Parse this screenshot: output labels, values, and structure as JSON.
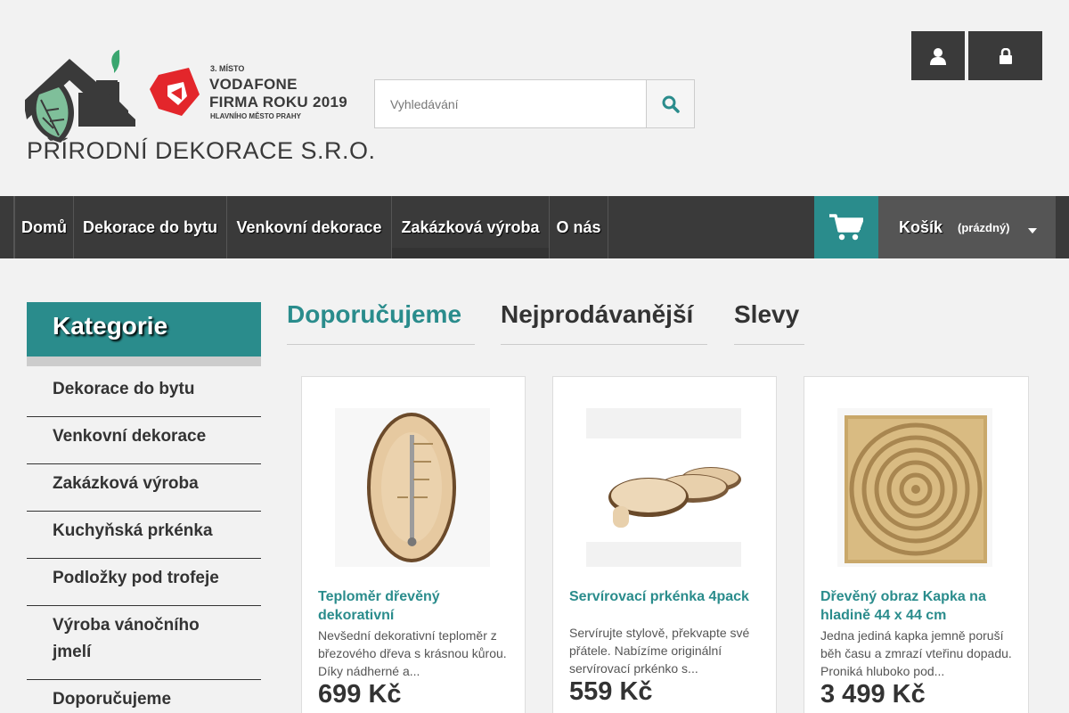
{
  "header": {
    "company_name": "PŘÍRODNÍ DEKORACE S.R.O.",
    "award_place": "3. MÍSTO",
    "award_line1": "VODAFONE",
    "award_line2": "FIRMA ROKU 2019",
    "award_line3": "HLAVNÍHO MĚSTO PRAHY",
    "search_placeholder": "Vyhledávání",
    "user_icon": "user-icon",
    "lock_icon": "lock-icon",
    "search_icon": "search-icon"
  },
  "nav": {
    "items": [
      {
        "label": "Domů"
      },
      {
        "label": "Dekorace do bytu"
      },
      {
        "label": "Venkovní dekorace"
      },
      {
        "label": "Zakázková výroba"
      },
      {
        "label": "O nás"
      }
    ]
  },
  "cart": {
    "label": "Košík",
    "status": "(prázdný)",
    "icon": "cart-icon"
  },
  "sidebar": {
    "heading": "Kategorie",
    "items": [
      {
        "label": "Dekorace do bytu"
      },
      {
        "label": "Venkovní dekorace"
      },
      {
        "label": "Zakázková výroba"
      },
      {
        "label": "Kuchyňská prkénka"
      },
      {
        "label": "Podložky pod trofeje"
      },
      {
        "label": "Výroba vánočního jmelí"
      },
      {
        "label": "Doporučujeme"
      }
    ]
  },
  "tabs": [
    {
      "label": "Doporučujeme",
      "active": true
    },
    {
      "label": "Nejprodávanější",
      "active": false
    },
    {
      "label": "Slevy",
      "active": false
    }
  ],
  "products": [
    {
      "title": "Teploměr dřevěný dekorativní",
      "description": "Nevšední dekorativní teploměr z březového dřeva s krásnou kůrou. Díky nádherné a...",
      "price": "699 Kč"
    },
    {
      "title": "Servírovací prkénka 4pack",
      "description": "Servírujte stylově, překvapte své přátele. Nabízíme originální servírovací prkénko s...",
      "price": "559 Kč"
    },
    {
      "title": "Dřevěný obraz Kapka na hladině 44 x 44 cm",
      "description": "Jedna jediná kapka jemně poruší běh času a zmrazí vteřinu dopadu. Proniká hluboko pod...",
      "price": "3 499 Kč"
    }
  ],
  "colors": {
    "accent": "#2a8c8c",
    "dark": "#3a3a3a",
    "brand_red": "#e3262b"
  }
}
